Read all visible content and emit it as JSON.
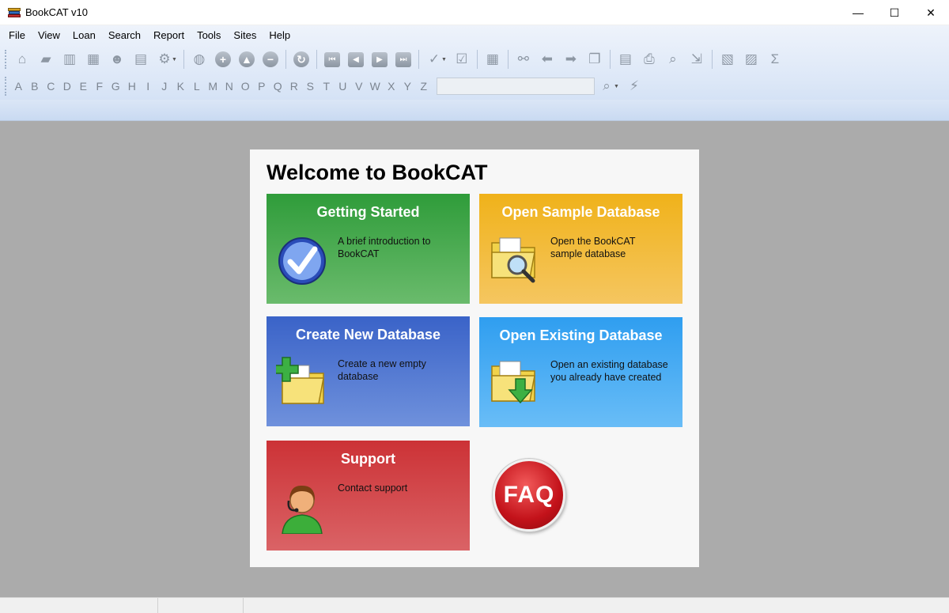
{
  "window": {
    "title": "BookCAT v10",
    "minimize": "—",
    "maximize": "☐",
    "close": "✕"
  },
  "menu": [
    "File",
    "View",
    "Loan",
    "Search",
    "Report",
    "Tools",
    "Sites",
    "Help"
  ],
  "toolbar": {
    "icons": [
      "home-icon",
      "book-icon",
      "open-book-icon",
      "table-icon",
      "users-icon",
      "form-icon",
      "settings-icon",
      "globe-icon",
      "add-icon",
      "up-icon",
      "remove-icon",
      "refresh-icon",
      "first-icon",
      "previous-icon",
      "next-icon",
      "last-icon",
      "check-icon",
      "edit-check-icon",
      "grid-icon",
      "handshake-icon",
      "back-arrow-icon",
      "forward-arrow-icon",
      "windows-icon",
      "report-icon",
      "print-icon",
      "preview-icon",
      "export-icon",
      "html-icon",
      "chart-icon",
      "sum-icon"
    ]
  },
  "alphabet": [
    "A",
    "B",
    "C",
    "D",
    "E",
    "F",
    "G",
    "H",
    "I",
    "J",
    "K",
    "L",
    "M",
    "N",
    "O",
    "P",
    "Q",
    "R",
    "S",
    "T",
    "U",
    "V",
    "W",
    "X",
    "Y",
    "Z"
  ],
  "search": {
    "value": ""
  },
  "welcome": {
    "title": "Welcome to BookCAT",
    "tiles": {
      "getting_started": {
        "title": "Getting Started",
        "desc": "A brief introduction to BookCAT"
      },
      "open_sample": {
        "title": "Open Sample Database",
        "desc": "Open the BookCAT sample database"
      },
      "create_new": {
        "title": "Create New Database",
        "desc": "Create a new empty database"
      },
      "open_existing": {
        "title": "Open Existing Database",
        "desc": "Open an existing database you already have created"
      },
      "support": {
        "title": "Support",
        "desc": "Contact support"
      }
    },
    "faq": "FAQ"
  },
  "colors": {
    "green": "#2f9c3a",
    "orange": "#f0b21a",
    "blue": "#3a63c8",
    "sky": "#2f9ef0",
    "red": "#cc3236",
    "workspace": "#ababab"
  }
}
